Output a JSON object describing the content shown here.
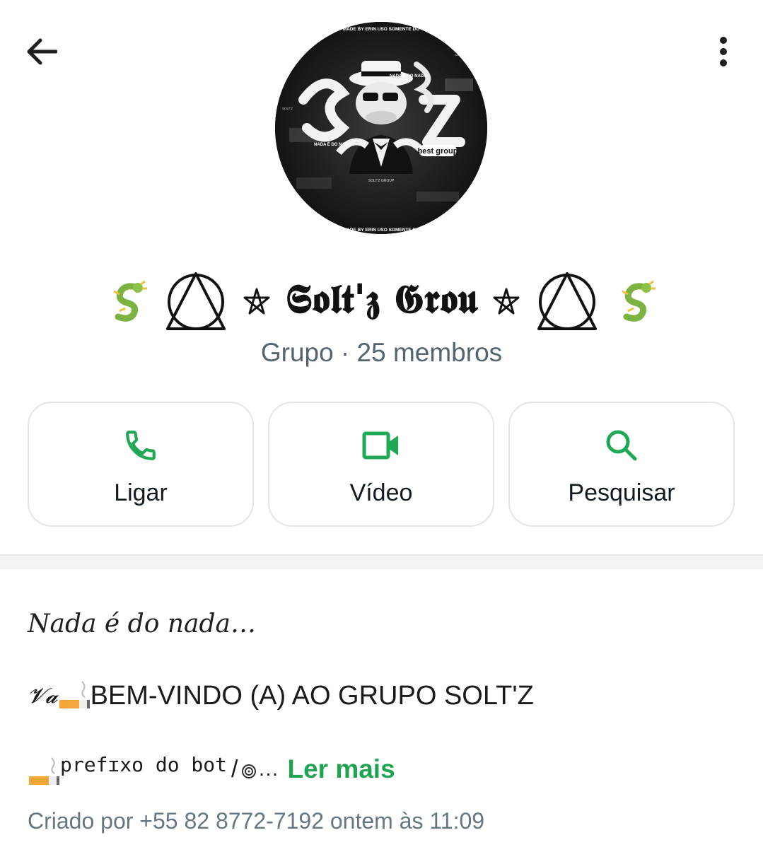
{
  "header": {
    "back_icon": "arrow-left-icon",
    "menu_icon": "more-vertical-icon"
  },
  "group": {
    "name": "𝕾𝖔𝖑𝖙'𝖟 𝕲𝖗𝖔𝖚",
    "subtitle": "Grupo · 25 membros",
    "avatar": {
      "texts": [
        "MADE BY ERIN USO SOMENTE DO",
        "NADA É DO NADA",
        "NADA É DO NADA",
        "best group",
        "SOLT'Z GROUP",
        "DON'T USE",
        "SOLT'Z"
      ]
    }
  },
  "actions": [
    {
      "label": "Ligar",
      "icon": "phone-icon"
    },
    {
      "label": "Vídeo",
      "icon": "video-camera-icon"
    },
    {
      "label": "Pesquisar",
      "icon": "search-icon"
    }
  ],
  "colors": {
    "accent": "#21a452",
    "icon_green": "#1fa855"
  },
  "description": {
    "title": "Nada é do nada…",
    "line1": "BEM-VINDO (A) AO GRUPO SOLT'Z",
    "line1_prefix": "𝓥𝓪",
    "line2": "prefɪxo do bot",
    "line2_slash": " / ",
    "line2_end": "…",
    "read_more": "Ler mais"
  },
  "created": "Criado por +55 82 8772-7192 ontem às 11:09"
}
